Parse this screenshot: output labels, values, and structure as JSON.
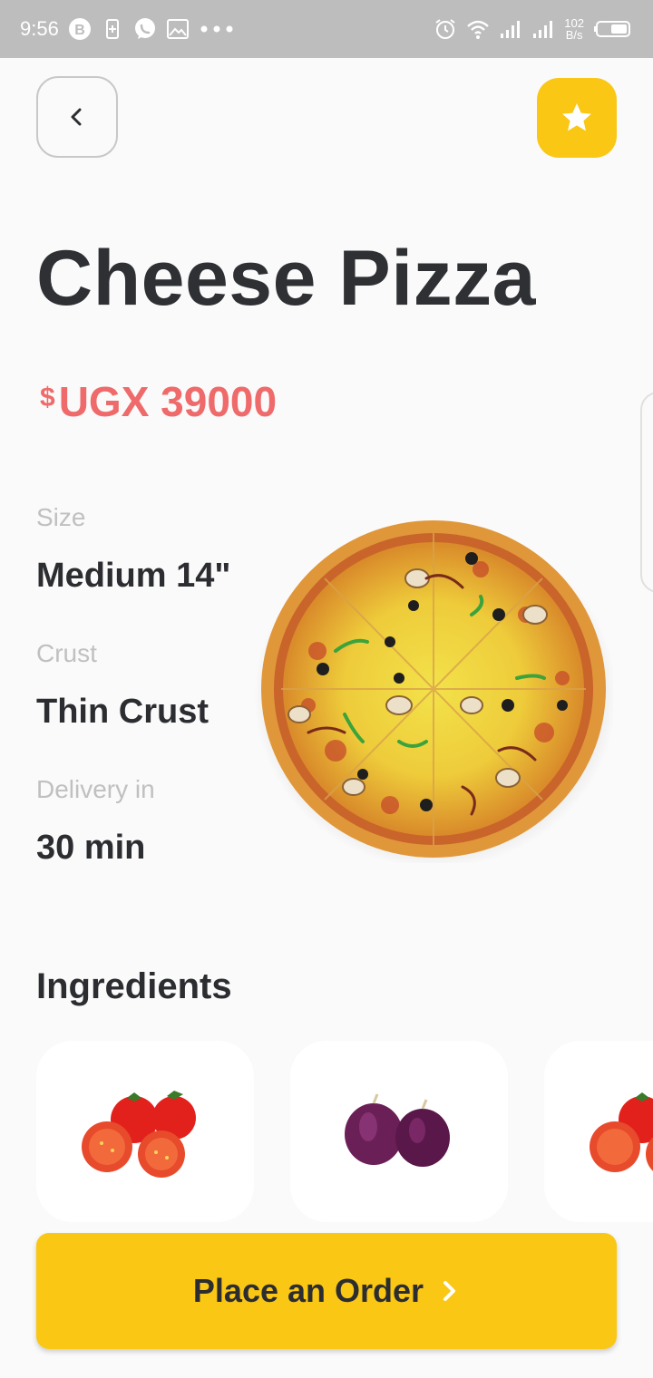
{
  "status_bar": {
    "time": "9:56",
    "net_speed_top": "102",
    "net_speed_bottom": "B/s"
  },
  "header": {
    "back_icon": "chevron-left-icon",
    "favorite_icon": "star-icon"
  },
  "product": {
    "title": "Cheese Pizza",
    "currency_symbol": "$",
    "price": "UGX 39000"
  },
  "specs": [
    {
      "label": "Size",
      "value": "Medium 14\""
    },
    {
      "label": "Crust",
      "value": "Thin Crust"
    },
    {
      "label": "Delivery in",
      "value": "30 min"
    }
  ],
  "ingredients": {
    "title": "Ingredients",
    "items": [
      "tomato-image",
      "onion-image",
      "tomato-image"
    ]
  },
  "order_button": {
    "label": "Place an Order",
    "icon": "chevron-right-icon"
  },
  "colors": {
    "accent": "#fac715",
    "price": "#ef6a6a",
    "text": "#2b2d30",
    "muted": "#c0c0c0",
    "status_bar": "#bdbdbd"
  }
}
